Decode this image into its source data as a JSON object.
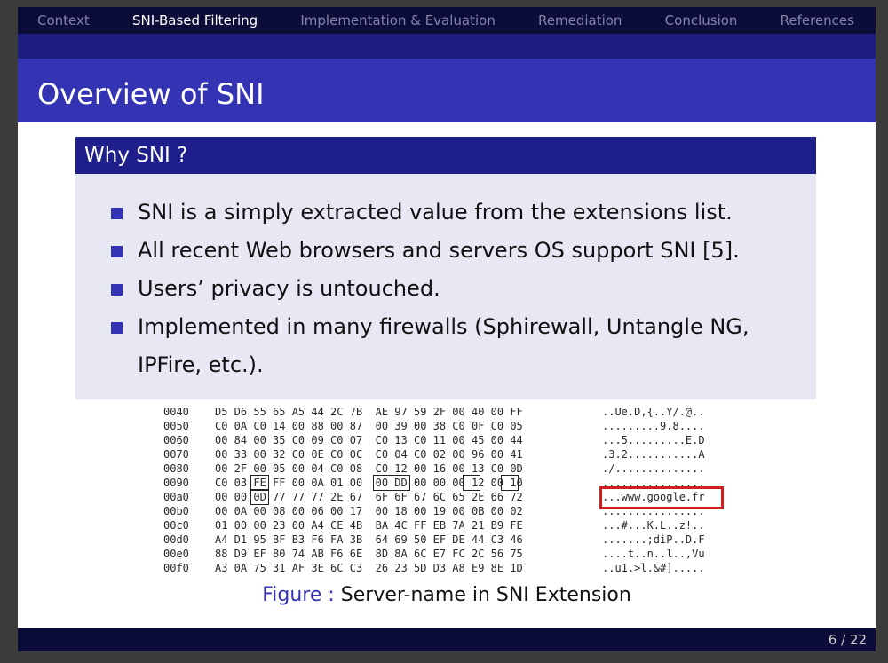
{
  "nav": {
    "items": [
      {
        "label": "Context",
        "active": false
      },
      {
        "label": "SNI-Based Filtering",
        "active": true
      },
      {
        "label": "Implementation & Evaluation",
        "active": false
      },
      {
        "label": "Remediation",
        "active": false
      },
      {
        "label": "Conclusion",
        "active": false
      },
      {
        "label": "References",
        "active": false
      }
    ]
  },
  "slide": {
    "title": "Overview of SNI",
    "block_title": "Why SNI ?",
    "bullets": [
      "SNI is a simply extracted value from the extensions list.",
      "All recent Web browsers and servers OS support SNI [5].",
      "Users’ privacy is untouched.",
      "Implemented in many firewalls (Sphirewall, Untangle NG, IPFire, etc.)."
    ]
  },
  "figure": {
    "hex_rows": [
      {
        "addr": "0040",
        "bytes": "D5 D6 55 65 A5 44 2C 7B  AE 97 59 2F 00 40 00 FF",
        "ascii": "..Ue.D,{..Y/.@.."
      },
      {
        "addr": "0050",
        "bytes": "C0 0A C0 14 00 88 00 87  00 39 00 38 C0 0F C0 05",
        "ascii": ".........9.8...."
      },
      {
        "addr": "0060",
        "bytes": "00 84 00 35 C0 09 C0 07  C0 13 C0 11 00 45 00 44",
        "ascii": "...5.........E.D"
      },
      {
        "addr": "0070",
        "bytes": "00 33 00 32 C0 0E C0 0C  C0 04 C0 02 00 96 00 41",
        "ascii": ".3.2...........A"
      },
      {
        "addr": "0080",
        "bytes": "00 2F 00 05 00 04 C0 08  C0 12 00 16 00 13 C0 0D",
        "ascii": "./.............."
      },
      {
        "addr": "0090",
        "bytes": "C0 03 FE FF 00 0A 01 00  00 DD 00 00 00 12 00 10",
        "ascii": "................"
      },
      {
        "addr": "00a0",
        "bytes": "00 00 0D 77 77 77 2E 67  6F 6F 67 6C 65 2E 66 72",
        "ascii": "...www.google.fr"
      },
      {
        "addr": "00b0",
        "bytes": "00 0A 00 08 00 06 00 17  00 18 00 19 00 0B 00 02",
        "ascii": "................"
      },
      {
        "addr": "00c0",
        "bytes": "01 00 00 23 00 A4 CE 4B  BA 4C FF EB 7A 21 B9 FE",
        "ascii": "...#...K.L..z!.."
      },
      {
        "addr": "00d0",
        "bytes": "A4 D1 95 BF B3 F6 FA 3B  64 69 50 EF DE 44 C3 46",
        "ascii": ".......;diP..D.F"
      },
      {
        "addr": "00e0",
        "bytes": "88 D9 EF 80 74 AB F6 6E  8D 8A 6C E7 FC 2C 56 75",
        "ascii": "....t..n..l..,Vu"
      },
      {
        "addr": "00f0",
        "bytes": "A3 0A 75 31 AF 3E 6C C3  26 23 5D D3 A8 E9 8E 1D",
        "ascii": "..u1.>l.&#]....."
      }
    ],
    "caption_label": "Figure :",
    "caption_text": "Server-name in SNI Extension"
  },
  "footer": {
    "page": "6 / 22"
  },
  "colors": {
    "nav_bg": "#0c0c38",
    "title_bg": "#3333b3",
    "block_head": "#1f1f8c",
    "block_body": "#e8e8f4",
    "highlight": "#d11f1f"
  }
}
